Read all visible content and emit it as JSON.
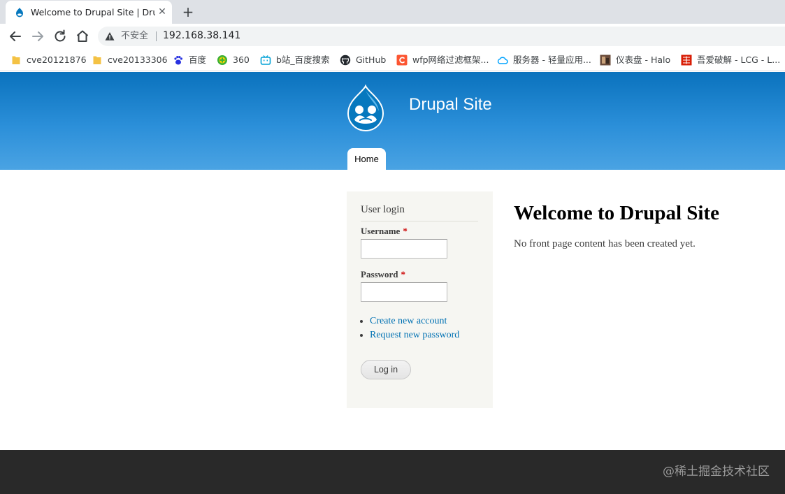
{
  "browser": {
    "tab_title": "Welcome to Drupal Site | Drupal Site",
    "close_glyph": "✕",
    "new_tab_glyph": "+",
    "security_text": "不安全",
    "url": "192.168.38.141"
  },
  "bookmarks": [
    {
      "label": "cve20121876",
      "icon": "folder-icon",
      "color": "#f4c244"
    },
    {
      "label": "cve20133306",
      "icon": "folder-icon",
      "color": "#f4c244"
    },
    {
      "label": "百度",
      "icon": "baidu-paw-icon",
      "color": "#2932e1"
    },
    {
      "label": "360",
      "icon": "360-icon",
      "color": "#3cb035"
    },
    {
      "label": "b站_百度搜索",
      "icon": "bilibili-tv-icon",
      "color": "#00a1d6"
    },
    {
      "label": "GitHub",
      "icon": "github-icon",
      "color": "#24292e"
    },
    {
      "label": "wfp网络过滤框架...",
      "icon": "csdn-c-icon",
      "color": "#fc5531"
    },
    {
      "label": "服务器 - 轻量应用...",
      "icon": "cloud-icon",
      "color": "#00a3ff"
    },
    {
      "label": "仪表盘 - Halo",
      "icon": "halo-thumbnail-icon",
      "color": "#6b4c3b"
    },
    {
      "label": "吾爱破解 - LCG - L...",
      "icon": "52pojie-seal-icon",
      "color": "#d81e06"
    }
  ],
  "site": {
    "name": "Drupal Site",
    "nav_home": "Home"
  },
  "login_block": {
    "title": "User login",
    "username_label": "Username",
    "password_label": "Password",
    "required_mark": "*",
    "create_account": "Create new account",
    "request_password": "Request new password",
    "login_button": "Log in"
  },
  "content": {
    "title": "Welcome to Drupal Site",
    "body": "No front page content has been created yet."
  },
  "footer": {
    "watermark": "@稀土掘金技术社区"
  },
  "colors": {
    "header_top": "#0a72bd",
    "header_bottom": "#4aa3e3",
    "link": "#0071b3",
    "footer": "#292929",
    "sidebar_bg": "#f6f6f2"
  }
}
